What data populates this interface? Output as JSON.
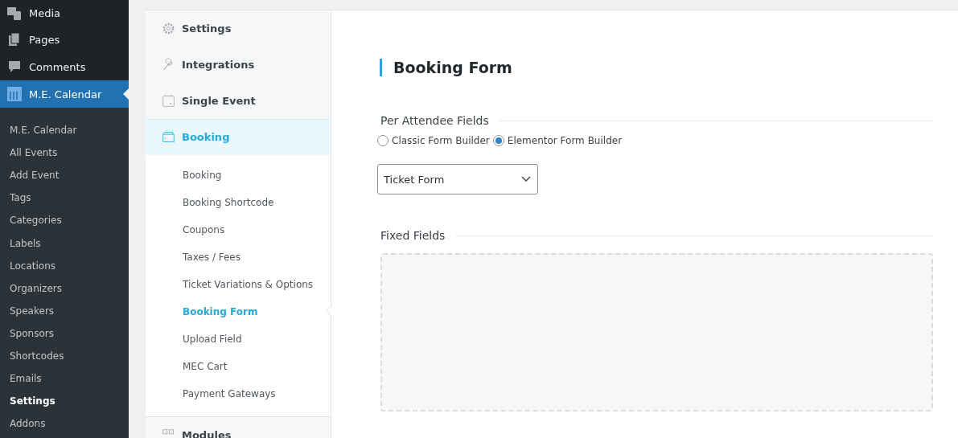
{
  "admin_menu": {
    "top_items": [
      {
        "label": "Media",
        "selected": false
      },
      {
        "label": "Pages",
        "selected": false
      },
      {
        "label": "Comments",
        "selected": false
      },
      {
        "label": "M.E. Calendar",
        "selected": true
      }
    ],
    "submenu": [
      {
        "label": "M.E. Calendar",
        "selected": false
      },
      {
        "label": "All Events",
        "selected": false
      },
      {
        "label": "Add Event",
        "selected": false
      },
      {
        "label": "Tags",
        "selected": false
      },
      {
        "label": "Categories",
        "selected": false
      },
      {
        "label": "Labels",
        "selected": false
      },
      {
        "label": "Locations",
        "selected": false
      },
      {
        "label": "Organizers",
        "selected": false
      },
      {
        "label": "Speakers",
        "selected": false
      },
      {
        "label": "Sponsors",
        "selected": false
      },
      {
        "label": "Shortcodes",
        "selected": false
      },
      {
        "label": "Emails",
        "selected": false
      },
      {
        "label": "Settings",
        "selected": true
      },
      {
        "label": "Addons",
        "selected": false
      }
    ]
  },
  "settings_nav": {
    "sections": [
      {
        "label": "Settings",
        "selected": false
      },
      {
        "label": "Integrations",
        "selected": false
      },
      {
        "label": "Single Event",
        "selected": false
      },
      {
        "label": "Booking",
        "selected": true,
        "children": [
          {
            "label": "Booking",
            "selected": false
          },
          {
            "label": "Booking Shortcode",
            "selected": false
          },
          {
            "label": "Coupons",
            "selected": false
          },
          {
            "label": "Taxes / Fees",
            "selected": false
          },
          {
            "label": "Ticket Variations & Options",
            "selected": false
          },
          {
            "label": "Booking Form",
            "selected": true
          },
          {
            "label": "Upload Field",
            "selected": false
          },
          {
            "label": "MEC Cart",
            "selected": false
          },
          {
            "label": "Payment Gateways",
            "selected": false
          }
        ]
      },
      {
        "label": "Modules",
        "selected": false
      }
    ]
  },
  "content": {
    "title": "Booking Form",
    "per_attendee": {
      "heading": "Per Attendee Fields",
      "options": [
        {
          "label": "Classic Form Builder",
          "selected": false
        },
        {
          "label": "Elementor Form Builder",
          "selected": true
        }
      ],
      "select_value": "Ticket Form"
    },
    "fixed_fields": {
      "heading": "Fixed Fields"
    }
  }
}
